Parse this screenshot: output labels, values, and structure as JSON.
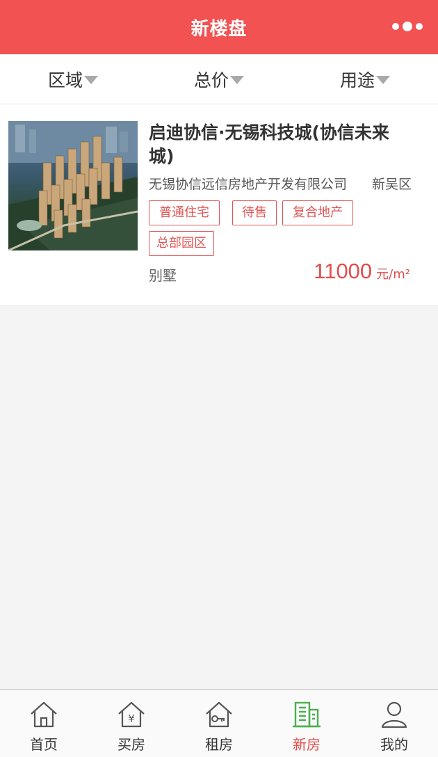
{
  "header": {
    "title": "新楼盘",
    "more_icon": "more-dots-icon"
  },
  "filters": [
    {
      "label": "区域",
      "icon": "caret-down-icon"
    },
    {
      "label": "总价",
      "icon": "caret-down-icon"
    },
    {
      "label": "用途",
      "icon": "caret-down-icon"
    }
  ],
  "listing": {
    "title": "启迪协信·无锡科技城(协信未来城)",
    "developer": "无锡协信远信房地产开发有限公司",
    "district": "新吴区",
    "tags": [
      "普通住宅",
      "待售",
      "复合地产",
      "总部园区"
    ],
    "usage": "别墅",
    "price": "11000",
    "price_unit": "元/m²"
  },
  "tabbar": {
    "items": [
      {
        "label": "首页",
        "icon": "home-icon",
        "active": false
      },
      {
        "label": "买房",
        "icon": "buy-house-icon",
        "active": false
      },
      {
        "label": "租房",
        "icon": "rent-house-icon",
        "active": false
      },
      {
        "label": "新房",
        "icon": "new-building-icon",
        "active": true
      },
      {
        "label": "我的",
        "icon": "user-icon",
        "active": false
      }
    ]
  },
  "colors": {
    "brand": "#f25252",
    "price": "#e44d4d",
    "active_icon": "#4caf50"
  }
}
